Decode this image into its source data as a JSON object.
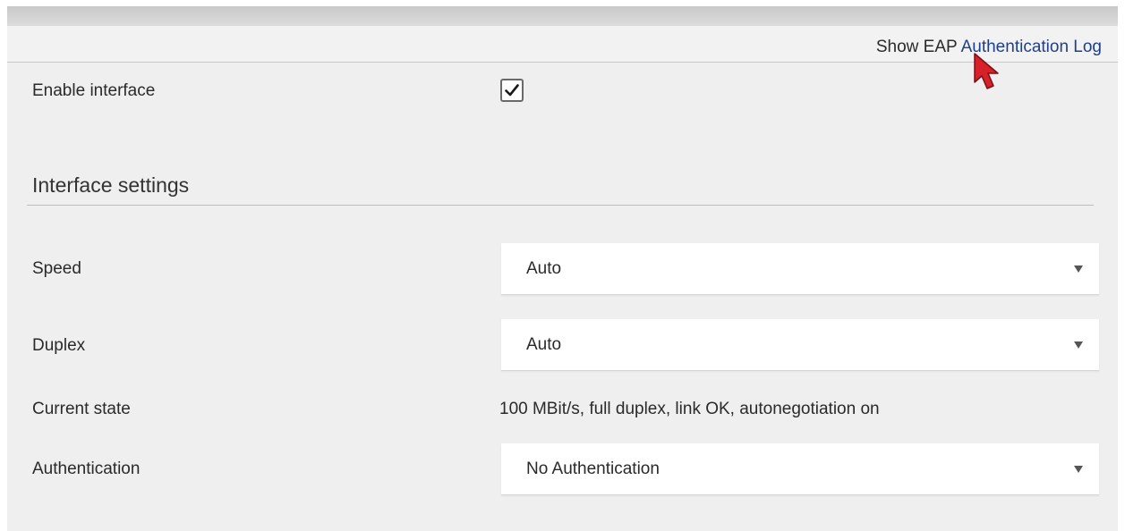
{
  "header": {
    "eap_prefix": "Show EAP ",
    "eap_link_text": "Authentication Log"
  },
  "enable_interface": {
    "label": "Enable interface",
    "checked": true
  },
  "interface_settings": {
    "title": "Interface settings"
  },
  "speed": {
    "label": "Speed",
    "value": "Auto"
  },
  "duplex": {
    "label": "Duplex",
    "value": "Auto"
  },
  "current_state": {
    "label": "Current state",
    "value": "100 MBit/s, full duplex, link OK, autonegotiation on"
  },
  "authentication": {
    "label": "Authentication",
    "value": "No Authentication"
  },
  "colors": {
    "link": "#1f3f8a",
    "panel_bg": "#efefef",
    "cursor": "#d6202a"
  },
  "icons": {
    "checkbox_mark": "checkmark-icon",
    "dropdown": "chevron-down-icon",
    "pointer": "mouse-cursor-icon"
  }
}
